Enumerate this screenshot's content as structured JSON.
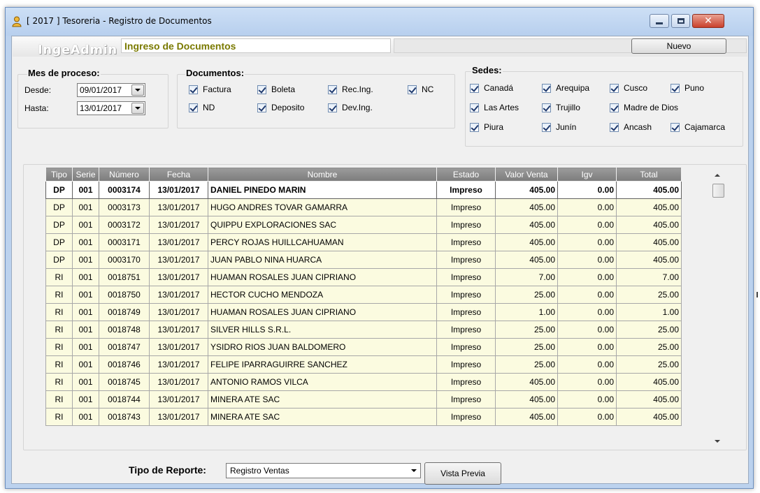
{
  "window": {
    "title": "[ 2017 ] Tesoreria - Registro de Documentos",
    "icon": "app-user-icon",
    "controls": [
      "minimize-icon",
      "maximize-icon",
      "close-icon"
    ],
    "close_glyph": "✕"
  },
  "header": {
    "logo": "IngeAdmin",
    "title": "Ingreso de Documentos",
    "nuevo_label": "Nuevo"
  },
  "mes_proceso": {
    "title": "Mes de proceso:",
    "desde_label": "Desde:",
    "desde_value": "09/01/2017",
    "hasta_label": "Hasta:",
    "hasta_value": "13/01/2017"
  },
  "documentos": {
    "title": "Documentos:",
    "items": [
      {
        "label": "Factura",
        "checked": true
      },
      {
        "label": "Boleta",
        "checked": true
      },
      {
        "label": "Rec.Ing.",
        "checked": true
      },
      {
        "label": "NC",
        "checked": true
      },
      {
        "label": "ND",
        "checked": true
      },
      {
        "label": "Deposito",
        "checked": true
      },
      {
        "label": "Dev.Ing.",
        "checked": true
      }
    ]
  },
  "sedes": {
    "title": "Sedes:",
    "items": [
      {
        "label": "Canadá",
        "checked": true
      },
      {
        "label": "Arequipa",
        "checked": true
      },
      {
        "label": "Cusco",
        "checked": true
      },
      {
        "label": "Puno",
        "checked": true
      },
      {
        "label": "Las Artes",
        "checked": true
      },
      {
        "label": "Trujillo",
        "checked": true
      },
      {
        "label": "Madre de Dios",
        "checked": true
      },
      {
        "label": "Piura",
        "checked": true
      },
      {
        "label": "Junín",
        "checked": true
      },
      {
        "label": "Ancash",
        "checked": true
      },
      {
        "label": "Cajamarca",
        "checked": true
      }
    ]
  },
  "table": {
    "columns": [
      "Tipo",
      "Serie",
      "Número",
      "Fecha",
      "Nombre",
      "Estado",
      "Valor Venta",
      "Igv",
      "Total"
    ],
    "rows": [
      [
        "DP",
        "001",
        "0003174",
        "13/01/2017",
        "DANIEL PINEDO MARIN",
        "Impreso",
        "405.00",
        "0.00",
        "405.00"
      ],
      [
        "DP",
        "001",
        "0003173",
        "13/01/2017",
        "HUGO ANDRES TOVAR GAMARRA",
        "Impreso",
        "405.00",
        "0.00",
        "405.00"
      ],
      [
        "DP",
        "001",
        "0003172",
        "13/01/2017",
        "QUIPPU EXPLORACIONES SAC",
        "Impreso",
        "405.00",
        "0.00",
        "405.00"
      ],
      [
        "DP",
        "001",
        "0003171",
        "13/01/2017",
        "PERCY ROJAS HUILLCAHUAMAN",
        "Impreso",
        "405.00",
        "0.00",
        "405.00"
      ],
      [
        "DP",
        "001",
        "0003170",
        "13/01/2017",
        "JUAN PABLO NINA HUARCA",
        "Impreso",
        "405.00",
        "0.00",
        "405.00"
      ],
      [
        "RI",
        "001",
        "0018751",
        "13/01/2017",
        "HUAMAN ROSALES JUAN CIPRIANO",
        "Impreso",
        "7.00",
        "0.00",
        "7.00"
      ],
      [
        "RI",
        "001",
        "0018750",
        "13/01/2017",
        "HECTOR CUCHO MENDOZA",
        "Impreso",
        "25.00",
        "0.00",
        "25.00"
      ],
      [
        "RI",
        "001",
        "0018749",
        "13/01/2017",
        "HUAMAN ROSALES JUAN CIPRIANO",
        "Impreso",
        "1.00",
        "0.00",
        "1.00"
      ],
      [
        "RI",
        "001",
        "0018748",
        "13/01/2017",
        "SILVER HILLS S.R.L.",
        "Impreso",
        "25.00",
        "0.00",
        "25.00"
      ],
      [
        "RI",
        "001",
        "0018747",
        "13/01/2017",
        "YSIDRO RIOS JUAN  BALDOMERO",
        "Impreso",
        "25.00",
        "0.00",
        "25.00"
      ],
      [
        "RI",
        "001",
        "0018746",
        "13/01/2017",
        "FELIPE IPARRAGUIRRE SANCHEZ",
        "Impreso",
        "25.00",
        "0.00",
        "25.00"
      ],
      [
        "RI",
        "001",
        "0018745",
        "13/01/2017",
        "ANTONIO RAMOS VILCA",
        "Impreso",
        "405.00",
        "0.00",
        "405.00"
      ],
      [
        "RI",
        "001",
        "0018744",
        "13/01/2017",
        "MINERA ATE SAC",
        "Impreso",
        "405.00",
        "0.00",
        "405.00"
      ],
      [
        "RI",
        "001",
        "0018743",
        "13/01/2017",
        "MINERA ATE SAC",
        "Impreso",
        "405.00",
        "0.00",
        "405.00"
      ]
    ],
    "selected_row": 0
  },
  "footer": {
    "tipo_label": "Tipo de Reporte:",
    "tipo_value": "Registro Ventas",
    "vista_label": "Vista Previa"
  },
  "colors": {
    "title_accent": "#7a7a00",
    "row_bg": "#fbfbe0",
    "header_bg": "#8c8c8c"
  }
}
